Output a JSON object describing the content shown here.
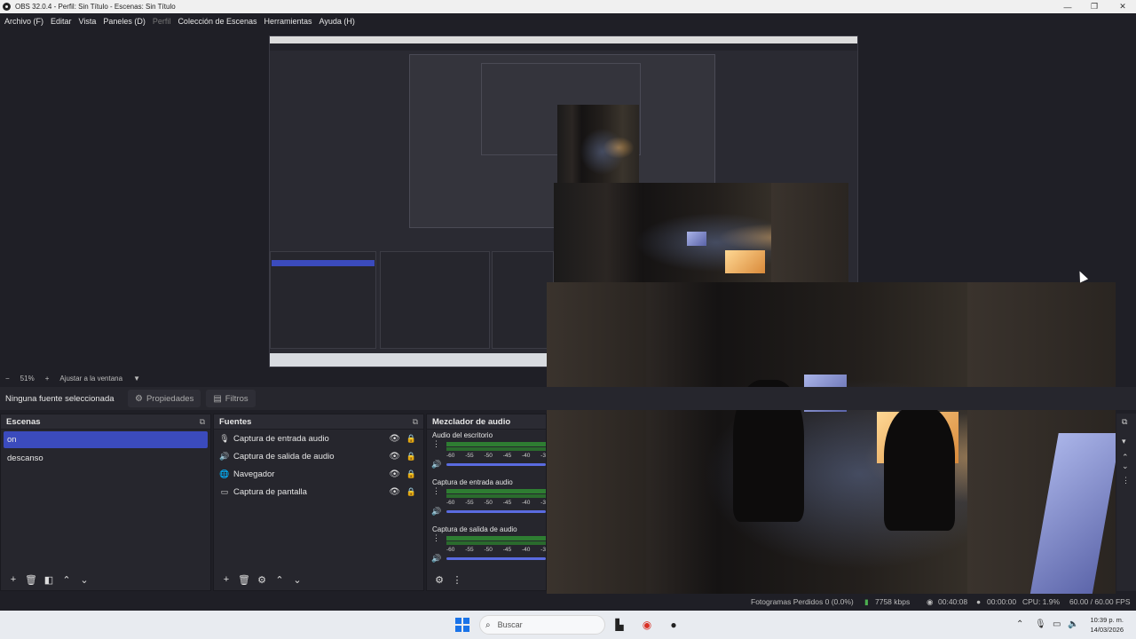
{
  "window": {
    "title": "OBS 32.0.4 - Perfil: Sin Título - Escenas: Sin Título",
    "controls": {
      "minimize": "—",
      "maximize": "❐",
      "close": "✕"
    }
  },
  "menu": [
    "Archivo (F)",
    "Editar",
    "Vista",
    "Paneles (D)",
    "Perfil",
    "Colección de Escenas",
    "Herramientas",
    "Ayuda (H)"
  ],
  "zoom": {
    "minus": "−",
    "value": "51%",
    "plus": "+",
    "fit": "Ajustar a la ventana",
    "arrow": "▼"
  },
  "source_toolbar": {
    "no_source": "Ninguna fuente seleccionada",
    "properties": "Propiedades",
    "filters": "Filtros"
  },
  "scenes": {
    "title": "Escenas",
    "items": [
      {
        "label": "on",
        "active": true
      },
      {
        "label": "descanso",
        "active": false
      }
    ]
  },
  "sources": {
    "title": "Fuentes",
    "items": [
      {
        "label": "Captura de entrada audio",
        "icon": "microphone-icon"
      },
      {
        "label": "Captura de salida de audio",
        "icon": "speaker-icon"
      },
      {
        "label": "Navegador",
        "icon": "globe-icon"
      },
      {
        "label": "Captura de pantalla",
        "icon": "monitor-icon"
      }
    ]
  },
  "mixer": {
    "title": "Mezclador de audio",
    "ticks": [
      "-60",
      "-55",
      "-50",
      "-45",
      "-40",
      "-3"
    ],
    "channels": [
      {
        "name": "Audio del escritorio"
      },
      {
        "name": "Captura de entrada audio"
      },
      {
        "name": "Captura de salida de audio"
      }
    ]
  },
  "statusbar": {
    "dropped": "Fotogramas Perdidos 0 (0.0%)",
    "bitrate": "7758 kbps",
    "stream_time": "00:40:08",
    "rec_time": "00:00:00",
    "cpu": "CPU: 1.9%",
    "fps": "60.00 / 60.00 FPS"
  },
  "taskbar": {
    "search_placeholder": "Buscar",
    "time": "10:39 p. m.",
    "date": "14/03/2026",
    "accent": "#1a73e8"
  }
}
